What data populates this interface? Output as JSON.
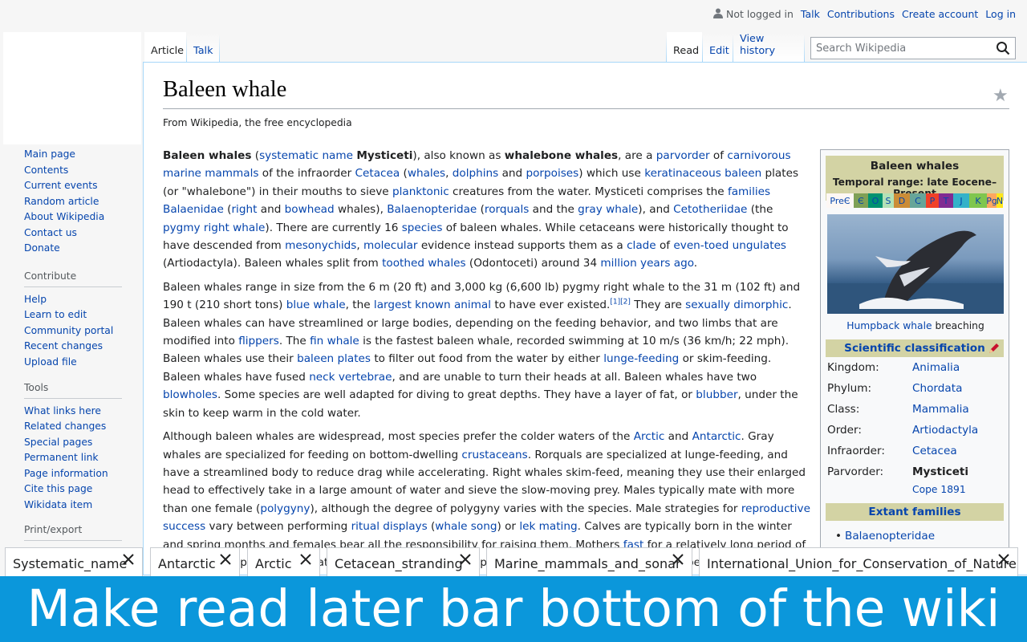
{
  "personal": {
    "not_logged_in": "Not logged in",
    "talk": "Talk",
    "contributions": "Contributions",
    "create_account": "Create account",
    "log_in": "Log in"
  },
  "tabs": {
    "article": "Article",
    "talk": "Talk",
    "read": "Read",
    "edit": "Edit",
    "view_history": "View history"
  },
  "search": {
    "placeholder": "Search Wikipedia"
  },
  "sidebar": {
    "nav": [
      "Main page",
      "Contents",
      "Current events",
      "Random article",
      "About Wikipedia",
      "Contact us",
      "Donate"
    ],
    "contribute_head": "Contribute",
    "contribute": [
      "Help",
      "Learn to edit",
      "Community portal",
      "Recent changes",
      "Upload file"
    ],
    "tools_head": "Tools",
    "tools": [
      "What links here",
      "Related changes",
      "Special pages",
      "Permanent link",
      "Page information",
      "Cite this page",
      "Wikidata item"
    ],
    "print_head": "Print/export"
  },
  "article": {
    "title": "Baleen whale",
    "tagline": "From Wikipedia, the free encyclopedia"
  },
  "infobox": {
    "title": "Baleen whales",
    "range": "Temporal range: late Eocene–Present",
    "timeline": [
      "PreЄ",
      "Є",
      "O",
      "S",
      "D",
      "C",
      "P",
      "T",
      "J",
      "K",
      "Pg",
      "N"
    ],
    "caption_link": "Humpback whale",
    "caption_rest": " breaching",
    "sci_head": "Scientific classification",
    "rows": [
      {
        "k": "Kingdom:",
        "v": "Animalia"
      },
      {
        "k": "Phylum:",
        "v": "Chordata"
      },
      {
        "k": "Class:",
        "v": "Mammalia"
      },
      {
        "k": "Order:",
        "v": "Artiodactyla"
      },
      {
        "k": "Infraorder:",
        "v": "Cetacea"
      },
      {
        "k": "Parvorder:",
        "v": "Mysticeti"
      }
    ],
    "authority": "Cope 1891",
    "families_head": "Extant families",
    "family1": "Balaenopteridae"
  },
  "read_later": [
    "Systematic_name",
    "Antarctic",
    "Arctic",
    "Cetacean_stranding",
    "Marine_mammals_and_sonar",
    "International_Union_for_Conservation_of_Nature"
  ],
  "banner": "Make read later bar bottom of the wiki",
  "colors": {
    "link": "#0645ad",
    "banner": "#0b97db",
    "infobox_head": "#d3d3a4"
  }
}
